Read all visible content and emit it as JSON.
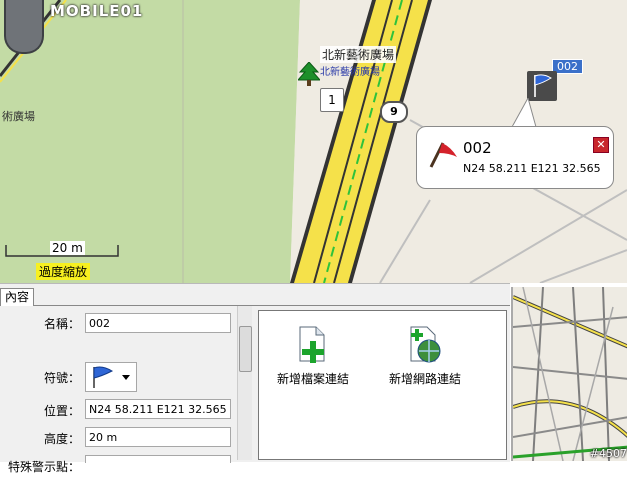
{
  "map": {
    "logo_text": "MOBILE01",
    "place_name": "北新藝術廣場",
    "place_sub": "北新藝術廣場",
    "left_place": "術廣場",
    "marker_number": "1",
    "road_shield": "9",
    "flag_badge": "002",
    "scale": "20 m",
    "overzoom": "過度縮放"
  },
  "callout": {
    "title": "002",
    "coords": "N24 58.211 E121 32.565",
    "close": "✕"
  },
  "panel": {
    "tab": "內容",
    "labels": {
      "name": "名稱：",
      "symbol": "符號：",
      "position": "位置：",
      "altitude": "高度：",
      "proximity": "特殊警示點："
    },
    "values": {
      "name": "002",
      "position": "N24 58.211 E121 32.565",
      "altitude": "20 m",
      "proximity": ""
    },
    "links": {
      "file": "新增檔案連結",
      "web": "新增網路連結"
    }
  },
  "minimap": {
    "tag": "#4507"
  },
  "colors": {
    "park_green": "#c3dba5",
    "road_yellow": "#f5e14a",
    "callout_close": "#c8262c",
    "overzoom_bg": "#f7f020"
  }
}
